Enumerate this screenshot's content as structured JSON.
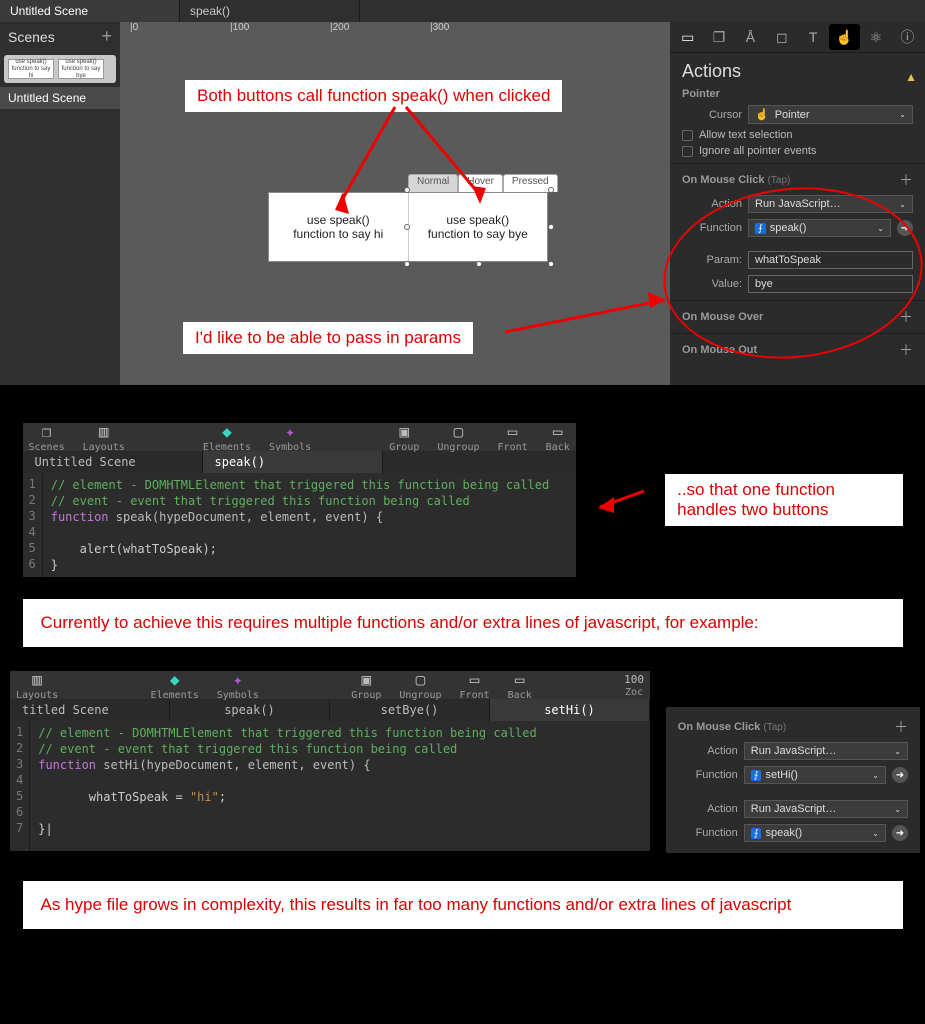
{
  "tabs": {
    "main": "Untitled Scene",
    "func": "speak()"
  },
  "scenesPanel": {
    "title": "Scenes",
    "thumb1": "use speak() function to say hi",
    "thumb2": "use speak() function to say bye",
    "item": "Untitled Scene"
  },
  "ruler": [
    "|0",
    "|100",
    "|200",
    "|300"
  ],
  "stateTabs": {
    "normal": "Normal",
    "hover": "Hover",
    "pressed": "Pressed"
  },
  "button1": {
    "l1": "use speak()",
    "l2": "function to say hi"
  },
  "button2": {
    "l1": "use speak()",
    "l2": "function to say bye"
  },
  "ann": {
    "top": "Both buttons call function speak() when clicked",
    "mid": "I'd like to be able to pass in params",
    "right": "..so that one function handles two buttons",
    "band1": "Currently to achieve this requires multiple functions and/or extra lines of javascript, for example:",
    "band2": "As hype file grows in complexity, this results in far too many functions and/or extra lines of javascript"
  },
  "inspector": {
    "title": "Actions",
    "section_pointer": "Pointer",
    "cursor_label": "Cursor",
    "cursor_value": "Pointer",
    "opt1": "Allow text selection",
    "opt2": "Ignore all pointer events",
    "section_click": "On Mouse Click",
    "click_hint": "(Tap)",
    "action_label": "Action",
    "action_value": "Run JavaScript…",
    "function_label": "Function",
    "function_value": "speak()",
    "param_label": "Param:",
    "param_value": "whatToSpeak",
    "value_label": "Value:",
    "value_value": "bye",
    "section_over": "On Mouse Over",
    "section_out": "On Mouse Out"
  },
  "codewin1": {
    "toolbar": {
      "scenes": "Scenes",
      "layouts": "Layouts",
      "elements": "Elements",
      "symbols": "Symbols",
      "group": "Group",
      "ungroup": "Ungroup",
      "front": "Front",
      "back": "Back"
    },
    "tab1": "Untitled Scene",
    "tab2": "speak()",
    "lines": [
      "1",
      "2",
      "3",
      "4",
      "5",
      "6"
    ],
    "c1": "// element - DOMHTMLElement that triggered this function being called",
    "c2": "// event - event that triggered this function being called",
    "kw": "function",
    "fn": " speak(hypeDocument, element, event) {",
    "body": "    alert(whatToSpeak);",
    "close": "}"
  },
  "codewin2": {
    "toolbar": {
      "layouts": "Layouts",
      "elements": "Elements",
      "symbols": "Symbols",
      "group": "Group",
      "ungroup": "Ungroup",
      "front": "Front",
      "back": "Back",
      "zoom": "100",
      "zoomlab": "Zoc"
    },
    "tab1": "titled Scene",
    "tab2": "speak()",
    "tab3": "setBye()",
    "tab4": "setHi()",
    "lines": [
      "1",
      "2",
      "3",
      "4",
      "5",
      "6",
      "7"
    ],
    "c1": "// element - DOMHTMLElement that triggered this function being called",
    "c2": "// event - event that triggered this function being called",
    "kw": "function",
    "fn": " setHi(hypeDocument, element, event) {",
    "body1": "       whatToSpeak = ",
    "body1s": "\"hi\"",
    "body1e": ";",
    "close": "}|"
  },
  "act2": {
    "title": "On Mouse Click",
    "hint": "(Tap)",
    "action_label": "Action",
    "action_value": "Run JavaScript…",
    "function_label": "Function",
    "fn1": "setHi()",
    "fn2": "speak()"
  }
}
